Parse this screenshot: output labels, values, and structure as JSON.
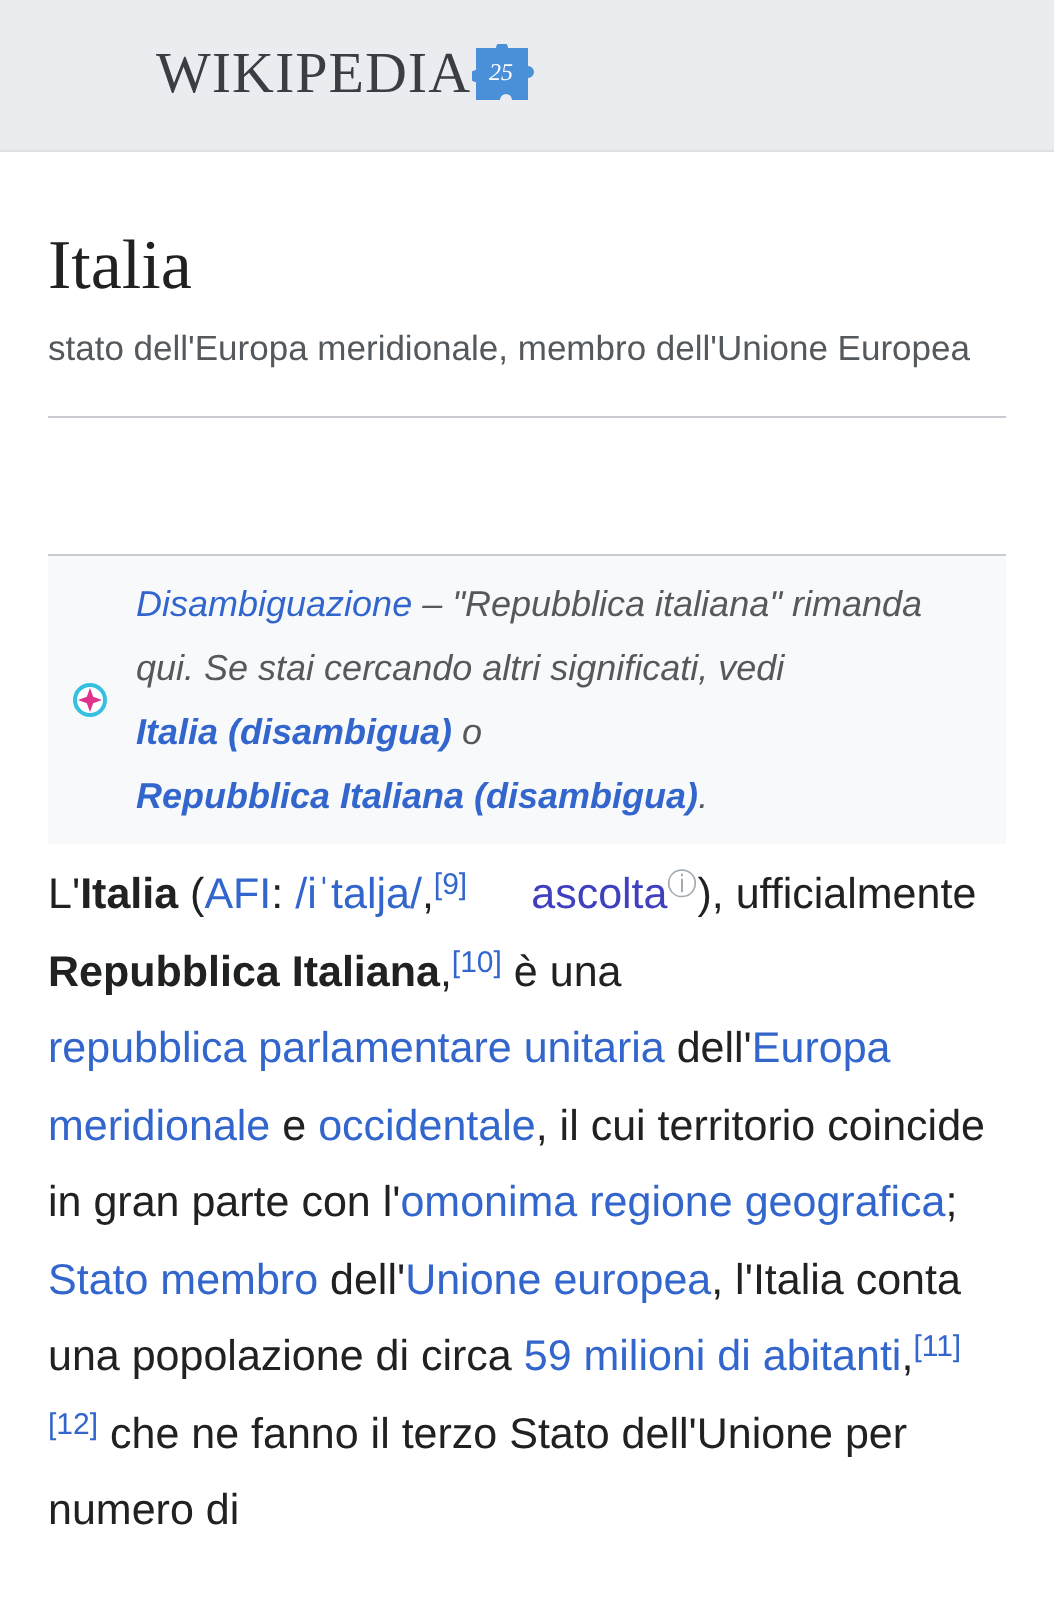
{
  "header": {
    "wordmark": "WIKIPEDIA",
    "badge": "25"
  },
  "article": {
    "title": "Italia",
    "description": "stato dell'Europa meridionale, membro dell'Unione Europea"
  },
  "hatnote": {
    "segments": [
      {
        "kind": "link",
        "text": "Disambiguazione"
      },
      {
        "kind": "text",
        "text": " – \"Repubblica italiana\" rimanda qui. Se stai cercando altri significati, vedi "
      },
      {
        "kind": "strong-link",
        "text": "Italia (disambigua)"
      },
      {
        "kind": "text",
        "text": " o "
      },
      {
        "kind": "strong-link",
        "text": "Repubblica Italiana (disambigua)"
      },
      {
        "kind": "text",
        "text": "."
      }
    ]
  },
  "paragraph": [
    {
      "kind": "text",
      "text": "L'"
    },
    {
      "kind": "bold",
      "text": "Italia"
    },
    {
      "kind": "text",
      "text": " ("
    },
    {
      "kind": "link",
      "text": "AFI"
    },
    {
      "kind": "text",
      "text": ": "
    },
    {
      "kind": "link",
      "text": "/iˈtalja/"
    },
    {
      "kind": "text",
      "text": ","
    },
    {
      "kind": "ref",
      "text": "[9]"
    },
    {
      "kind": "audio",
      "text": "ascolta",
      "info": "ⓘ"
    },
    {
      "kind": "text",
      "text": "), ufficialmente "
    },
    {
      "kind": "bold",
      "text": "Repubblica Italiana"
    },
    {
      "kind": "text",
      "text": ","
    },
    {
      "kind": "ref",
      "text": "[10]"
    },
    {
      "kind": "text",
      "text": " è una "
    },
    {
      "kind": "link",
      "text": "repubblica parlamentare unitaria"
    },
    {
      "kind": "text",
      "text": " dell'"
    },
    {
      "kind": "link",
      "text": "Europa"
    },
    {
      "kind": "link",
      "text": "meridionale"
    },
    {
      "kind": "text",
      "text": " e "
    },
    {
      "kind": "link",
      "text": "occidentale"
    },
    {
      "kind": "text",
      "text": ", il cui territorio coincide in gran parte con l'"
    },
    {
      "kind": "link",
      "text": "omonima regione"
    },
    {
      "kind": "link",
      "text": "geografica"
    },
    {
      "kind": "text",
      "text": "; "
    },
    {
      "kind": "link",
      "text": "Stato membro"
    },
    {
      "kind": "text",
      "text": " dell'"
    },
    {
      "kind": "link",
      "text": "Unione"
    },
    {
      "kind": "link",
      "text": "europea"
    },
    {
      "kind": "text",
      "text": ", l'Italia conta una popolazione di circa "
    },
    {
      "kind": "link",
      "text": "59 milioni di abitanti"
    },
    {
      "kind": "text",
      "text": ","
    },
    {
      "kind": "ref",
      "text": "[11]"
    },
    {
      "kind": "ref",
      "text": "[12]"
    },
    {
      "kind": "text",
      "text": " che ne fanno il terzo Stato dell'Unione per numero di"
    }
  ]
}
